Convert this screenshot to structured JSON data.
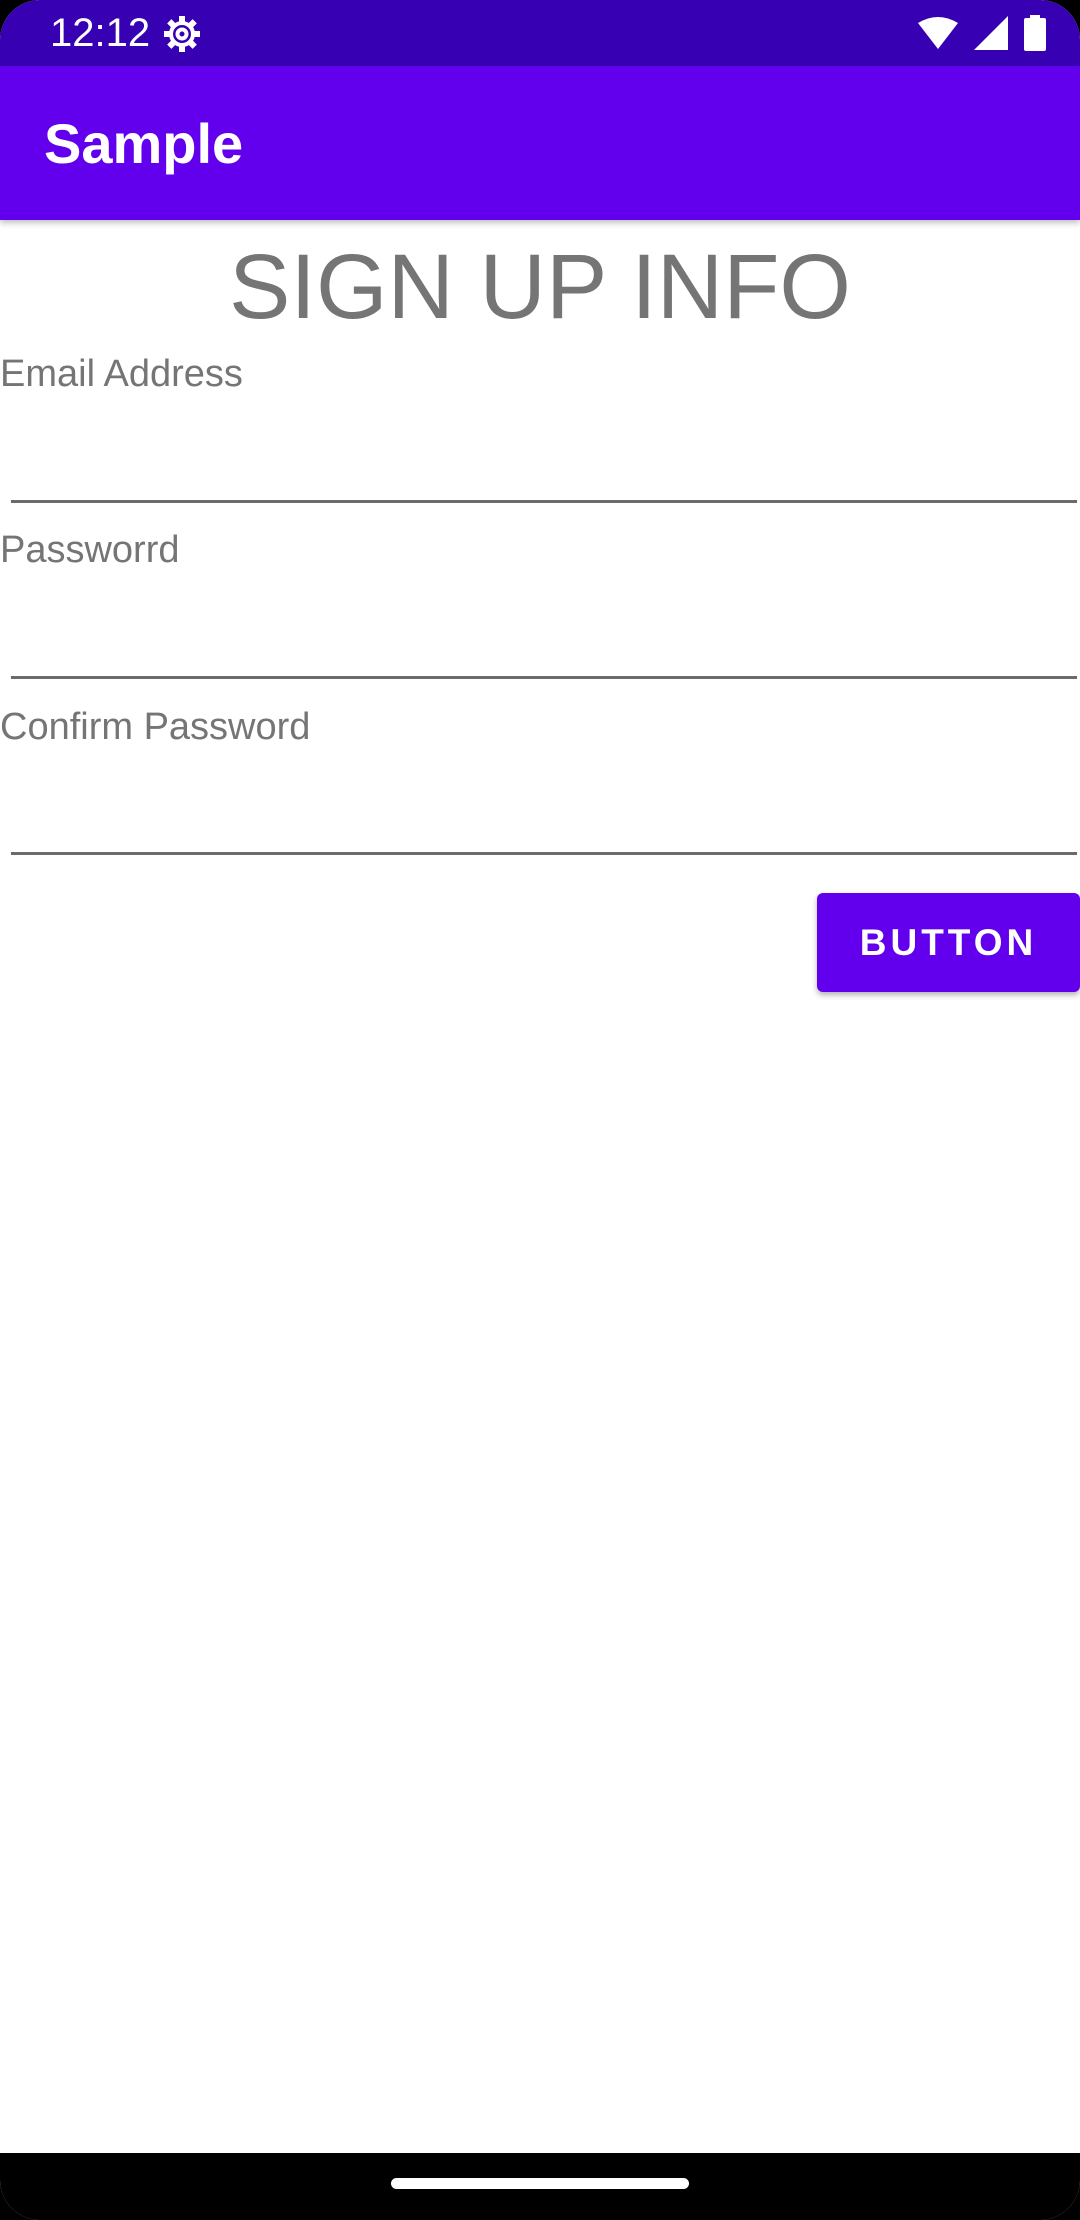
{
  "status_bar": {
    "time": "12:12",
    "icons": [
      "settings-gear-icon",
      "wifi-icon",
      "cellular-signal-icon",
      "battery-icon"
    ]
  },
  "app_bar": {
    "title": "Sample"
  },
  "form": {
    "heading": "SIGN UP INFO",
    "email": {
      "label": "Email Address",
      "value": ""
    },
    "password": {
      "label": "Passworrd",
      "value": ""
    },
    "confirm_password": {
      "label": "Confirm Password",
      "value": ""
    },
    "button_label": "BUTTON"
  },
  "colors": {
    "primary": "#6200EE",
    "primary_dark": "#3700B3",
    "label_text": "#757575"
  }
}
